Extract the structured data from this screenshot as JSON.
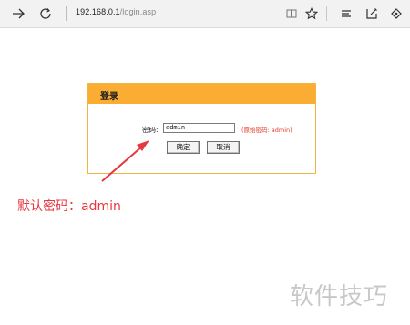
{
  "browser": {
    "url_host": "192.168.0.1",
    "url_path": "/login.asp",
    "icons": [
      "back-arrow-icon",
      "refresh-icon",
      "reading-view-icon",
      "favorite-star-icon",
      "hub-icon",
      "web-note-icon",
      "share-icon"
    ]
  },
  "login": {
    "title": "登录",
    "password_label": "密码:",
    "password_value": "admin",
    "hint": "(原始密码: admin)",
    "ok_label": "确定",
    "cancel_label": "取消",
    "header_color": "#fbad33",
    "hint_color": "#e23b2a"
  },
  "annotation": {
    "caption": "默认密码：admin",
    "color": "#e8373f"
  },
  "watermark": {
    "text": "软件技巧"
  }
}
